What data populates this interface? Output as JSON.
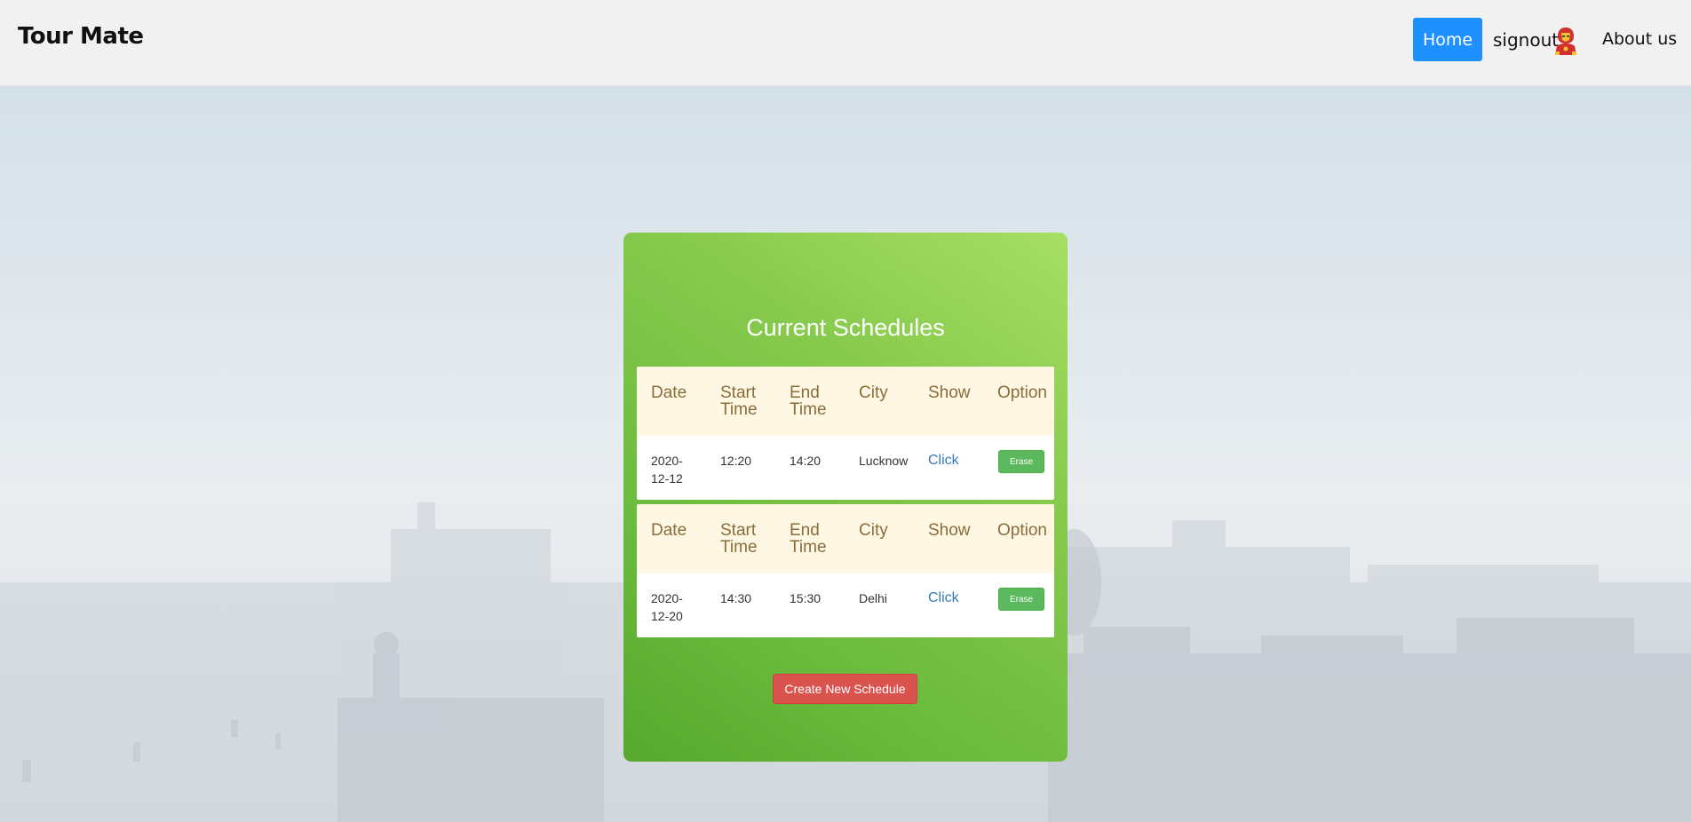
{
  "navbar": {
    "brand": "Tour Mate",
    "home_label": "Home",
    "signout_label": "signout",
    "avatar_icon": "ironman-avatar-icon",
    "about_label": "About us",
    "home_color": "#1e90ff"
  },
  "schedules": {
    "title": "Current Schedules",
    "columns": [
      "Date",
      "Start Time",
      "End Time",
      "City",
      "Show",
      "Option"
    ],
    "rows": [
      {
        "date": "2020-12-12",
        "start": "12:20",
        "end": "14:20",
        "city": "Lucknow",
        "show": "Click",
        "option": "Erase"
      },
      {
        "date": "2020-12-20",
        "start": "14:30",
        "end": "15:30",
        "city": "Delhi",
        "show": "Click",
        "option": "Erase"
      }
    ],
    "create_label": "Create New Schedule"
  },
  "colors": {
    "card_green": "#86c94c",
    "header_text": "#8a6d3b",
    "header_bg": "#fdf7e3",
    "erase_green": "#5cb85c",
    "create_red": "#d9534f",
    "link_blue": "#337ab7"
  }
}
